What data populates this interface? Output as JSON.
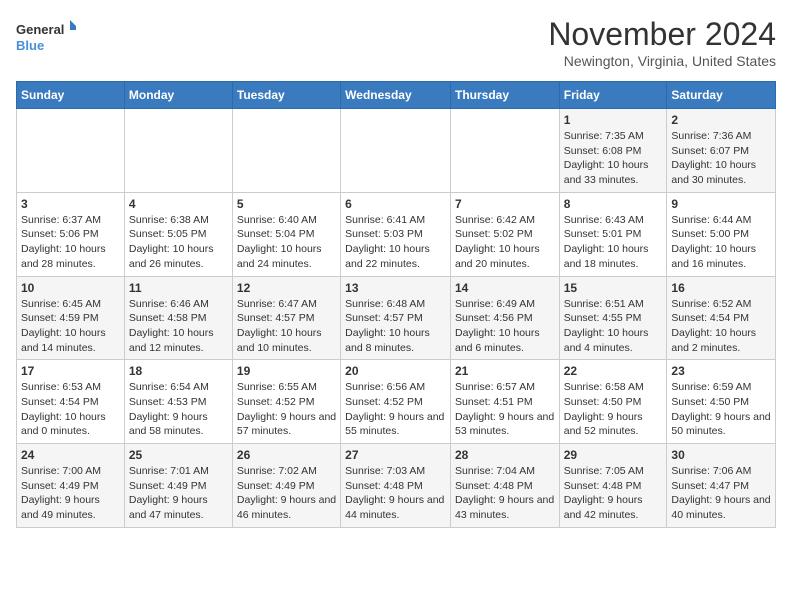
{
  "header": {
    "logo_line1": "General",
    "logo_line2": "Blue",
    "month": "November 2024",
    "location": "Newington, Virginia, United States"
  },
  "weekdays": [
    "Sunday",
    "Monday",
    "Tuesday",
    "Wednesday",
    "Thursday",
    "Friday",
    "Saturday"
  ],
  "weeks": [
    [
      {
        "day": "",
        "info": ""
      },
      {
        "day": "",
        "info": ""
      },
      {
        "day": "",
        "info": ""
      },
      {
        "day": "",
        "info": ""
      },
      {
        "day": "",
        "info": ""
      },
      {
        "day": "1",
        "info": "Sunrise: 7:35 AM\nSunset: 6:08 PM\nDaylight: 10 hours and 33 minutes."
      },
      {
        "day": "2",
        "info": "Sunrise: 7:36 AM\nSunset: 6:07 PM\nDaylight: 10 hours and 30 minutes."
      }
    ],
    [
      {
        "day": "3",
        "info": "Sunrise: 6:37 AM\nSunset: 5:06 PM\nDaylight: 10 hours and 28 minutes."
      },
      {
        "day": "4",
        "info": "Sunrise: 6:38 AM\nSunset: 5:05 PM\nDaylight: 10 hours and 26 minutes."
      },
      {
        "day": "5",
        "info": "Sunrise: 6:40 AM\nSunset: 5:04 PM\nDaylight: 10 hours and 24 minutes."
      },
      {
        "day": "6",
        "info": "Sunrise: 6:41 AM\nSunset: 5:03 PM\nDaylight: 10 hours and 22 minutes."
      },
      {
        "day": "7",
        "info": "Sunrise: 6:42 AM\nSunset: 5:02 PM\nDaylight: 10 hours and 20 minutes."
      },
      {
        "day": "8",
        "info": "Sunrise: 6:43 AM\nSunset: 5:01 PM\nDaylight: 10 hours and 18 minutes."
      },
      {
        "day": "9",
        "info": "Sunrise: 6:44 AM\nSunset: 5:00 PM\nDaylight: 10 hours and 16 minutes."
      }
    ],
    [
      {
        "day": "10",
        "info": "Sunrise: 6:45 AM\nSunset: 4:59 PM\nDaylight: 10 hours and 14 minutes."
      },
      {
        "day": "11",
        "info": "Sunrise: 6:46 AM\nSunset: 4:58 PM\nDaylight: 10 hours and 12 minutes."
      },
      {
        "day": "12",
        "info": "Sunrise: 6:47 AM\nSunset: 4:57 PM\nDaylight: 10 hours and 10 minutes."
      },
      {
        "day": "13",
        "info": "Sunrise: 6:48 AM\nSunset: 4:57 PM\nDaylight: 10 hours and 8 minutes."
      },
      {
        "day": "14",
        "info": "Sunrise: 6:49 AM\nSunset: 4:56 PM\nDaylight: 10 hours and 6 minutes."
      },
      {
        "day": "15",
        "info": "Sunrise: 6:51 AM\nSunset: 4:55 PM\nDaylight: 10 hours and 4 minutes."
      },
      {
        "day": "16",
        "info": "Sunrise: 6:52 AM\nSunset: 4:54 PM\nDaylight: 10 hours and 2 minutes."
      }
    ],
    [
      {
        "day": "17",
        "info": "Sunrise: 6:53 AM\nSunset: 4:54 PM\nDaylight: 10 hours and 0 minutes."
      },
      {
        "day": "18",
        "info": "Sunrise: 6:54 AM\nSunset: 4:53 PM\nDaylight: 9 hours and 58 minutes."
      },
      {
        "day": "19",
        "info": "Sunrise: 6:55 AM\nSunset: 4:52 PM\nDaylight: 9 hours and 57 minutes."
      },
      {
        "day": "20",
        "info": "Sunrise: 6:56 AM\nSunset: 4:52 PM\nDaylight: 9 hours and 55 minutes."
      },
      {
        "day": "21",
        "info": "Sunrise: 6:57 AM\nSunset: 4:51 PM\nDaylight: 9 hours and 53 minutes."
      },
      {
        "day": "22",
        "info": "Sunrise: 6:58 AM\nSunset: 4:50 PM\nDaylight: 9 hours and 52 minutes."
      },
      {
        "day": "23",
        "info": "Sunrise: 6:59 AM\nSunset: 4:50 PM\nDaylight: 9 hours and 50 minutes."
      }
    ],
    [
      {
        "day": "24",
        "info": "Sunrise: 7:00 AM\nSunset: 4:49 PM\nDaylight: 9 hours and 49 minutes."
      },
      {
        "day": "25",
        "info": "Sunrise: 7:01 AM\nSunset: 4:49 PM\nDaylight: 9 hours and 47 minutes."
      },
      {
        "day": "26",
        "info": "Sunrise: 7:02 AM\nSunset: 4:49 PM\nDaylight: 9 hours and 46 minutes."
      },
      {
        "day": "27",
        "info": "Sunrise: 7:03 AM\nSunset: 4:48 PM\nDaylight: 9 hours and 44 minutes."
      },
      {
        "day": "28",
        "info": "Sunrise: 7:04 AM\nSunset: 4:48 PM\nDaylight: 9 hours and 43 minutes."
      },
      {
        "day": "29",
        "info": "Sunrise: 7:05 AM\nSunset: 4:48 PM\nDaylight: 9 hours and 42 minutes."
      },
      {
        "day": "30",
        "info": "Sunrise: 7:06 AM\nSunset: 4:47 PM\nDaylight: 9 hours and 40 minutes."
      }
    ]
  ]
}
